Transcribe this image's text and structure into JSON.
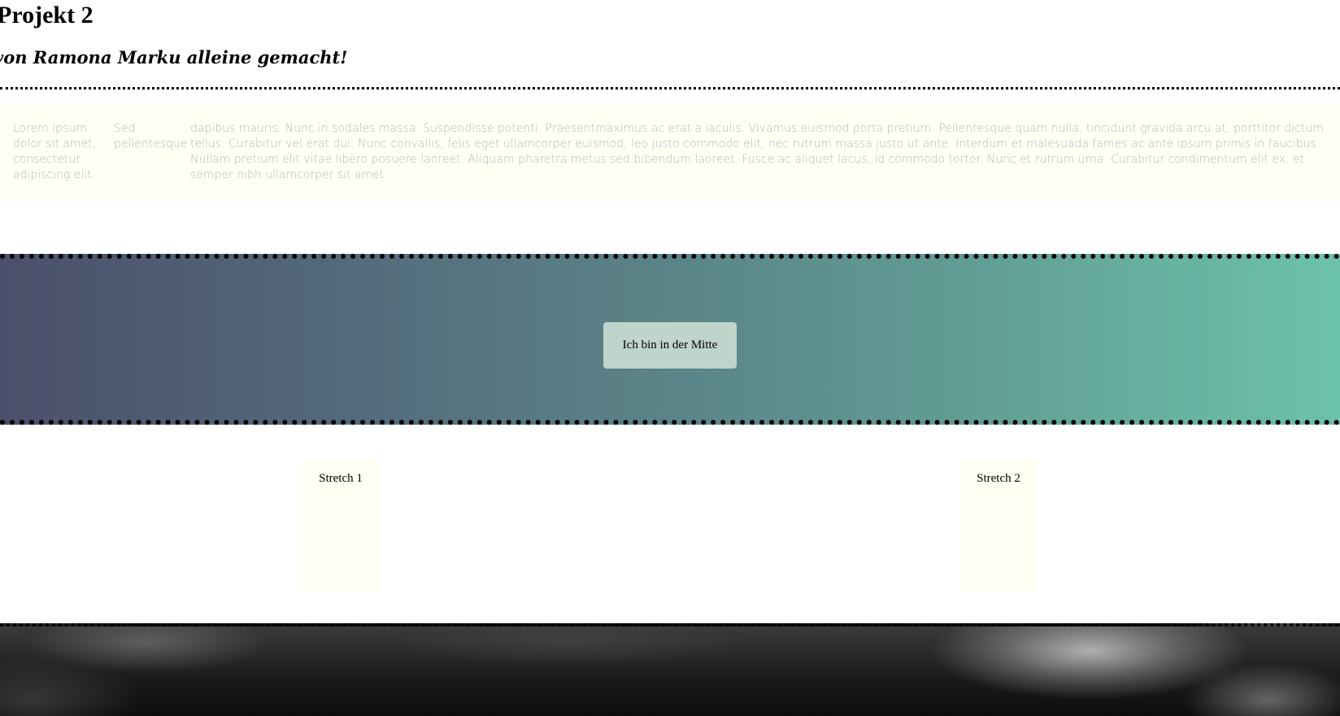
{
  "header": {
    "title": "Projekt 2",
    "subtitle": "von Ramona Marku alleine gemacht!"
  },
  "text_section": {
    "col1": "Lorem ipsum dolor sit amet, consectetur adipiscing elit.",
    "col2": "Sed pellentesque",
    "col3": "dapibus mauris. Nunc in sodales massa. Suspendisse potenti. Praesentmaximus ac erat a iaculis. Vivamus euismod porta pretium. Pellentesque quam nulla, tincidunt gravida arcu at, porttitor dictum tellus. Curabitur vel erat dui. Nunc convallis, felis eget ullamcorper euismod, leo justo commodo elit, nec rutrum massa justo ut ante. Interdum et malesuada fames ac ante ipsum primis in faucibus. Nullam pretium elit vitae libero posuere laoreet. Aliquam pharetra metus sed bibendum laoreet. Fusce ac aliquet lacus, id commodo tortor. Nunc et rutrum urna. Curabitur condimentum elit ex, et semper nibh ullamcorper sit amet."
  },
  "center_section": {
    "box_label": "Ich bin in der Mitte",
    "gradient_colors": [
      "#4b4f6b",
      "#6cc2a9"
    ],
    "box_color": "#bfd4ca"
  },
  "stretch_section": {
    "stretch1_label": "Stretch 1",
    "stretch2_label": "Stretch 2",
    "box_color": "#fffff4"
  },
  "image_section": {
    "description_icon": "dark-texture-image"
  }
}
